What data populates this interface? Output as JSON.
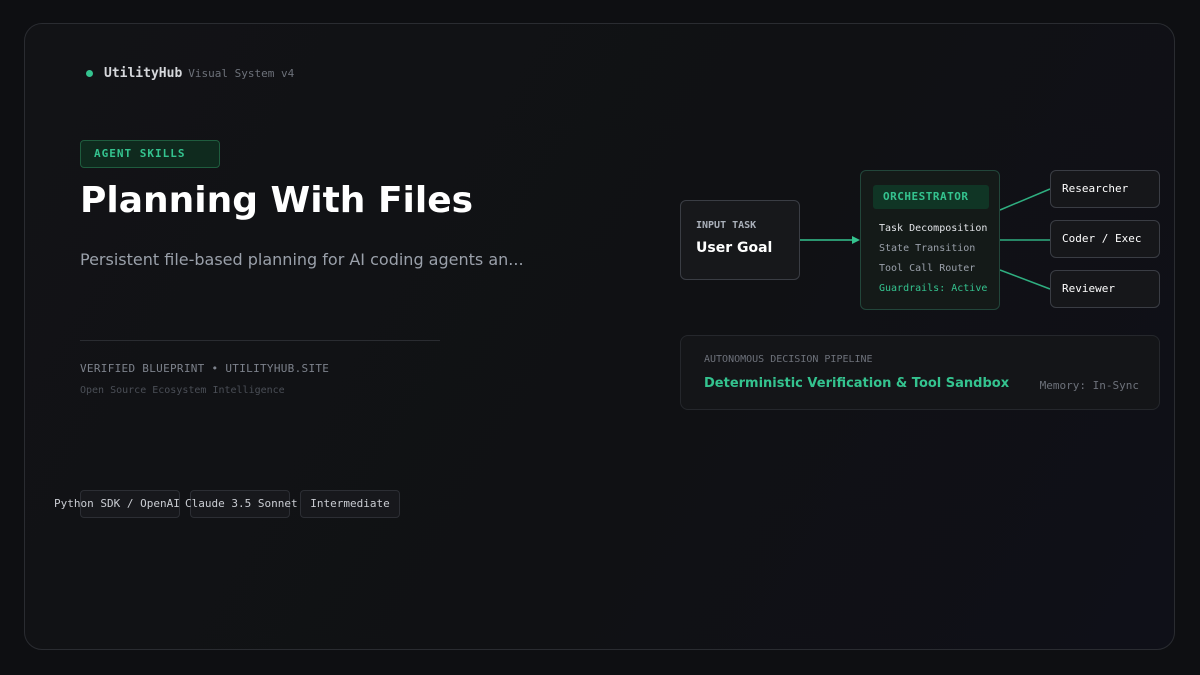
{
  "brand": {
    "name": "UtilityHub",
    "subtitle": "Visual System v4"
  },
  "hero": {
    "badge": "AGENT SKILLS",
    "title": "Planning With Files",
    "subtitle": "Persistent file-based planning for AI coding agents an...",
    "verified": "VERIFIED BLUEPRINT • UTILITYHUB.SITE",
    "ecosystem": "Open Source Ecosystem Intelligence"
  },
  "tags": [
    "Python SDK / OpenAI",
    "Claude 3.5 Sonnet",
    "Intermediate"
  ],
  "diagram": {
    "input": {
      "label": "INPUT TASK",
      "value": "User Goal"
    },
    "orchestrator": {
      "label": "ORCHESTRATOR",
      "items": [
        "Task Decomposition",
        "State Transition",
        "Tool Call Router",
        "Guardrails: Active"
      ]
    },
    "agents": [
      "Researcher",
      "Coder / Exec",
      "Reviewer"
    ],
    "pipeline": {
      "label": "AUTONOMOUS DECISION PIPELINE",
      "title": "Deterministic Verification & Tool Sandbox",
      "memory": "Memory: In-Sync"
    }
  },
  "colors": {
    "accent": "#34c38f",
    "background": "#0e0f12",
    "text": "#ffffff",
    "muted": "#9aa0aa"
  }
}
